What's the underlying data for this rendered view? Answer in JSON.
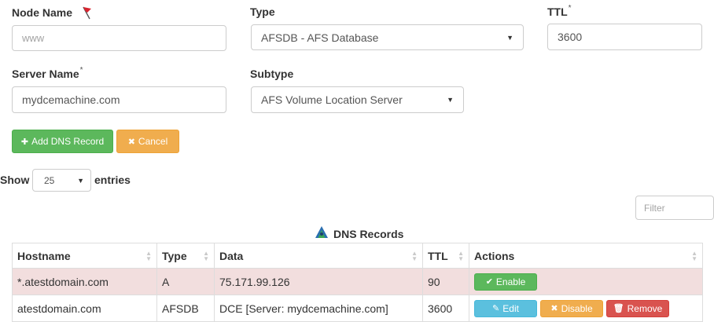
{
  "form": {
    "node_name": {
      "label": "Node Name",
      "placeholder": "www"
    },
    "type": {
      "label": "Type",
      "value": "AFSDB - AFS Database"
    },
    "ttl": {
      "label": "TTL",
      "required_mark": "*",
      "value": "3600"
    },
    "server_name": {
      "label": "Server Name",
      "required_mark": "*",
      "value": "mydcemachine.com"
    },
    "subtype": {
      "label": "Subtype",
      "value": "AFS Volume Location Server"
    },
    "add_button": "Add DNS Record",
    "cancel_button": "Cancel"
  },
  "table_controls": {
    "show_label": "Show",
    "entries_value": "25",
    "entries_label": "entries",
    "filter_placeholder": "Filter"
  },
  "table": {
    "caption": "DNS Records",
    "columns": [
      "Hostname",
      "Type",
      "Data",
      "TTL",
      "Actions"
    ],
    "rows": [
      {
        "hostname": "*.atestdomain.com",
        "type": "A",
        "data": "75.171.99.126",
        "ttl": "90",
        "actions": [
          "Enable"
        ]
      },
      {
        "hostname": "atestdomain.com",
        "type": "AFSDB",
        "data": "DCE [Server: mydcemachine.com]",
        "ttl": "3600",
        "actions": [
          "Edit",
          "Disable",
          "Remove"
        ]
      }
    ]
  },
  "icons": {
    "node_name_flag": "red-flag-icon",
    "caption_logo": "dns-records-icon"
  },
  "colors": {
    "success": "#5cb85c",
    "warning": "#f0ad4e",
    "info": "#5bc0de",
    "danger": "#d9534f",
    "danger_row_bg": "#f2dede"
  }
}
